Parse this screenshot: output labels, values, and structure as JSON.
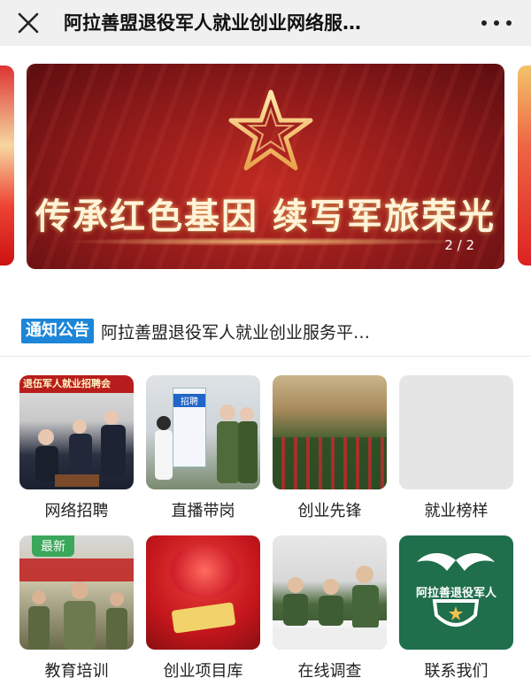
{
  "header": {
    "title": "阿拉善盟退役军人就业创业网络服…",
    "close_icon": "close-icon",
    "more_icon": "more-icon"
  },
  "carousel": {
    "slogan": "传承红色基因 续写军旅荣光",
    "counter": "2 / 2",
    "accent": "#b3201f",
    "star_color": "#ffd88a"
  },
  "notice": {
    "badge": "通知公告",
    "text": "阿拉善盟退役军人就业创业服务平…",
    "badge_color": "#1d86d8"
  },
  "thumbnails": {
    "recruit_banner_text": "退伍军人就业招聘会",
    "live_sign_text": "招聘",
    "new_badge": "最新",
    "logo_text": "阿拉善退役军人"
  },
  "grid": [
    {
      "label": "网络招聘"
    },
    {
      "label": "直播带岗"
    },
    {
      "label": "创业先锋"
    },
    {
      "label": "就业榜样"
    },
    {
      "label": "教育培训"
    },
    {
      "label": "创业项目库"
    },
    {
      "label": "在线调查"
    },
    {
      "label": "联系我们"
    }
  ]
}
